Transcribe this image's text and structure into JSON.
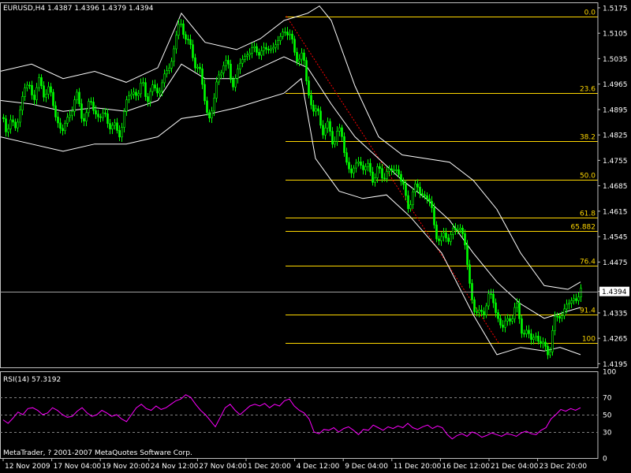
{
  "header": {
    "symbol_line": "EURUSD,H4  1.4387 1.4396 1.4379 1.4394",
    "rsi_line": "RSI(14) 57.3192",
    "copyright": "MetaTrader, ? 2001-2007 MetaQuotes Software Corp."
  },
  "colors": {
    "background": "#000000",
    "candle": "#00ff00",
    "band": "#ffffff",
    "fib": "#ffd700",
    "fib_trend": "#ff0000",
    "rsi": "#ff00ff",
    "grid": "#808080"
  },
  "chart_data": [
    {
      "type": "candlestick",
      "title": "EURUSD,H4",
      "current_price": 1.4394,
      "ohlc": {
        "open": 1.4387,
        "high": 1.4396,
        "low": 1.4379,
        "close": 1.4394
      },
      "y_ticks": [
        "1.5175",
        "1.5105",
        "1.5035",
        "1.4965",
        "1.4895",
        "1.4825",
        "1.4755",
        "1.4685",
        "1.4615",
        "1.4545",
        "1.4475",
        "1.4394",
        "1.4335",
        "1.4265",
        "1.4195"
      ],
      "ylim": [
        1.4185,
        1.519
      ],
      "close_path": [
        [
          0,
          1.489
        ],
        [
          6,
          1.484
        ],
        [
          12,
          1.487
        ],
        [
          18,
          1.483
        ],
        [
          24,
          1.489
        ],
        [
          30,
          1.495
        ],
        [
          36,
          1.496
        ],
        [
          42,
          1.493
        ],
        [
          48,
          1.497
        ],
        [
          54,
          1.494
        ],
        [
          60,
          1.496
        ],
        [
          66,
          1.491
        ],
        [
          72,
          1.487
        ],
        [
          78,
          1.483
        ],
        [
          84,
          1.486
        ],
        [
          90,
          1.49
        ],
        [
          96,
          1.493
        ],
        [
          102,
          1.489
        ],
        [
          108,
          1.487
        ],
        [
          114,
          1.492
        ],
        [
          120,
          1.489
        ],
        [
          126,
          1.487
        ],
        [
          132,
          1.488
        ],
        [
          138,
          1.486
        ],
        [
          144,
          1.484
        ],
        [
          150,
          1.483
        ],
        [
          156,
          1.487
        ],
        [
          162,
          1.493
        ],
        [
          168,
          1.495
        ],
        [
          174,
          1.493
        ],
        [
          180,
          1.497
        ],
        [
          186,
          1.493
        ],
        [
          192,
          1.494
        ],
        [
          198,
          1.496
        ],
        [
          204,
          1.495
        ],
        [
          210,
          1.5
        ],
        [
          216,
          1.502
        ],
        [
          222,
          1.509
        ],
        [
          228,
          1.513
        ],
        [
          234,
          1.511
        ],
        [
          240,
          1.506
        ],
        [
          246,
          1.503
        ],
        [
          252,
          1.501
        ],
        [
          258,
          1.493
        ],
        [
          264,
          1.487
        ],
        [
          270,
          1.491
        ],
        [
          276,
          1.498
        ],
        [
          282,
          1.503
        ],
        [
          288,
          1.501
        ],
        [
          294,
          1.497
        ],
        [
          300,
          1.499
        ],
        [
          306,
          1.503
        ],
        [
          312,
          1.505
        ],
        [
          318,
          1.506
        ],
        [
          324,
          1.505
        ],
        [
          330,
          1.507
        ],
        [
          336,
          1.504
        ],
        [
          342,
          1.508
        ],
        [
          348,
          1.506
        ],
        [
          354,
          1.509
        ],
        [
          360,
          1.512
        ],
        [
          366,
          1.51
        ],
        [
          372,
          1.506
        ],
        [
          378,
          1.504
        ],
        [
          384,
          1.503
        ],
        [
          390,
          1.496
        ],
        [
          396,
          1.488
        ],
        [
          402,
          1.49
        ],
        [
          408,
          1.483
        ],
        [
          414,
          1.486
        ],
        [
          420,
          1.48
        ],
        [
          426,
          1.484
        ],
        [
          432,
          1.482
        ],
        [
          438,
          1.477
        ],
        [
          444,
          1.471
        ],
        [
          450,
          1.474
        ],
        [
          456,
          1.476
        ],
        [
          462,
          1.472
        ],
        [
          468,
          1.474
        ],
        [
          474,
          1.47
        ],
        [
          480,
          1.473
        ],
        [
          486,
          1.471
        ],
        [
          492,
          1.473
        ],
        [
          498,
          1.472
        ],
        [
          504,
          1.474
        ],
        [
          510,
          1.468
        ],
        [
          516,
          1.463
        ],
        [
          522,
          1.466
        ],
        [
          528,
          1.468
        ],
        [
          534,
          1.467
        ],
        [
          540,
          1.465
        ],
        [
          546,
          1.463
        ],
        [
          552,
          1.456
        ],
        [
          558,
          1.452
        ],
        [
          564,
          1.456
        ],
        [
          570,
          1.454
        ],
        [
          576,
          1.456
        ],
        [
          582,
          1.458
        ],
        [
          588,
          1.454
        ],
        [
          594,
          1.442
        ],
        [
          600,
          1.436
        ],
        [
          606,
          1.432
        ],
        [
          612,
          1.434
        ],
        [
          618,
          1.438
        ],
        [
          624,
          1.437
        ],
        [
          630,
          1.433
        ],
        [
          636,
          1.429
        ],
        [
          642,
          1.431
        ],
        [
          648,
          1.433
        ],
        [
          654,
          1.435
        ],
        [
          660,
          1.43
        ],
        [
          666,
          1.428
        ],
        [
          672,
          1.426
        ],
        [
          678,
          1.428
        ],
        [
          684,
          1.425
        ],
        [
          690,
          1.424
        ],
        [
          696,
          1.423
        ],
        [
          702,
          1.43
        ],
        [
          708,
          1.434
        ],
        [
          714,
          1.433
        ],
        [
          720,
          1.436
        ],
        [
          726,
          1.438
        ],
        [
          732,
          1.437
        ],
        [
          736,
          1.439
        ]
      ],
      "bollinger": {
        "upper": [
          [
            0,
            1.5
          ],
          [
            40,
            1.502
          ],
          [
            80,
            1.498
          ],
          [
            120,
            1.5
          ],
          [
            160,
            1.497
          ],
          [
            200,
            1.501
          ],
          [
            230,
            1.516
          ],
          [
            260,
            1.508
          ],
          [
            300,
            1.506
          ],
          [
            330,
            1.509
          ],
          [
            360,
            1.514
          ],
          [
            390,
            1.516
          ],
          [
            405,
            1.518
          ],
          [
            420,
            1.514
          ],
          [
            450,
            1.496
          ],
          [
            480,
            1.482
          ],
          [
            510,
            1.477
          ],
          [
            540,
            1.476
          ],
          [
            570,
            1.475
          ],
          [
            600,
            1.47
          ],
          [
            630,
            1.462
          ],
          [
            660,
            1.45
          ],
          [
            690,
            1.441
          ],
          [
            720,
            1.44
          ],
          [
            736,
            1.442
          ]
        ],
        "middle": [
          [
            0,
            1.492
          ],
          [
            40,
            1.491
          ],
          [
            80,
            1.489
          ],
          [
            120,
            1.49
          ],
          [
            160,
            1.489
          ],
          [
            200,
            1.492
          ],
          [
            230,
            1.502
          ],
          [
            260,
            1.498
          ],
          [
            300,
            1.498
          ],
          [
            330,
            1.501
          ],
          [
            360,
            1.504
          ],
          [
            390,
            1.501
          ],
          [
            420,
            1.491
          ],
          [
            450,
            1.482
          ],
          [
            480,
            1.476
          ],
          [
            510,
            1.47
          ],
          [
            540,
            1.465
          ],
          [
            570,
            1.459
          ],
          [
            600,
            1.45
          ],
          [
            630,
            1.442
          ],
          [
            660,
            1.436
          ],
          [
            690,
            1.432
          ],
          [
            720,
            1.434
          ],
          [
            736,
            1.435
          ]
        ],
        "lower": [
          [
            0,
            1.482
          ],
          [
            40,
            1.48
          ],
          [
            80,
            1.478
          ],
          [
            120,
            1.48
          ],
          [
            160,
            1.48
          ],
          [
            200,
            1.482
          ],
          [
            230,
            1.487
          ],
          [
            260,
            1.488
          ],
          [
            300,
            1.49
          ],
          [
            330,
            1.492
          ],
          [
            360,
            1.494
          ],
          [
            382,
            1.498
          ],
          [
            400,
            1.476
          ],
          [
            430,
            1.467
          ],
          [
            460,
            1.465
          ],
          [
            490,
            1.466
          ],
          [
            520,
            1.46
          ],
          [
            560,
            1.45
          ],
          [
            600,
            1.433
          ],
          [
            630,
            1.422
          ],
          [
            660,
            1.424
          ],
          [
            690,
            1.423
          ],
          [
            710,
            1.424
          ],
          [
            736,
            1.422
          ]
        ]
      },
      "fibonacci": {
        "high": 1.5152,
        "low": 1.4253,
        "levels": [
          {
            "label": "0.0",
            "ratio": 0.0
          },
          {
            "label": "23.6",
            "ratio": 0.236
          },
          {
            "label": "38.2",
            "ratio": 0.382
          },
          {
            "label": "50.0",
            "ratio": 0.5
          },
          {
            "label": "61.8",
            "ratio": 0.618
          },
          {
            "label": "65.882",
            "ratio": 0.65882
          },
          {
            "label": "76.4",
            "ratio": 0.764
          },
          {
            "label": "91.4",
            "ratio": 0.914
          },
          {
            "label": "100",
            "ratio": 1.0
          }
        ]
      }
    },
    {
      "type": "line",
      "title": "RSI(14)",
      "last_value": 57.3192,
      "y_ticks": [
        "100",
        "70",
        "50",
        "30",
        "0"
      ],
      "ylim": [
        0,
        100
      ],
      "guides": [
        70,
        50,
        30
      ],
      "values": [
        44,
        40,
        46,
        53,
        50,
        57,
        58,
        55,
        50,
        52,
        58,
        55,
        50,
        47,
        48,
        54,
        58,
        52,
        48,
        50,
        55,
        52,
        48,
        50,
        45,
        42,
        50,
        58,
        62,
        57,
        55,
        60,
        56,
        58,
        62,
        66,
        68,
        73,
        70,
        62,
        55,
        50,
        43,
        36,
        47,
        58,
        62,
        55,
        50,
        55,
        60,
        62,
        60,
        63,
        58,
        62,
        60,
        66,
        68,
        60,
        55,
        52,
        45,
        30,
        28,
        33,
        32,
        35,
        30,
        34,
        36,
        32,
        27,
        33,
        32,
        38,
        35,
        32,
        36,
        34,
        37,
        35,
        40,
        35,
        33,
        36,
        38,
        34,
        37,
        35,
        27,
        22,
        26,
        28,
        25,
        30,
        28,
        24,
        26,
        29,
        27,
        25,
        28,
        27,
        25,
        29,
        31,
        28,
        27,
        32,
        35,
        45,
        50,
        56,
        54,
        57,
        55,
        58
      ]
    }
  ],
  "x_ticks": [
    "12 Nov 2009",
    "17 Nov 04:00",
    "19 Nov 20:00",
    "24 Nov 12:00",
    "27 Nov 04:00",
    "1 Dec 20:00",
    "4 Dec 12:00",
    "9 Dec 04:00",
    "11 Dec 20:00",
    "16 Dec 12:00",
    "21 Dec 04:00",
    "23 Dec 20:00"
  ]
}
